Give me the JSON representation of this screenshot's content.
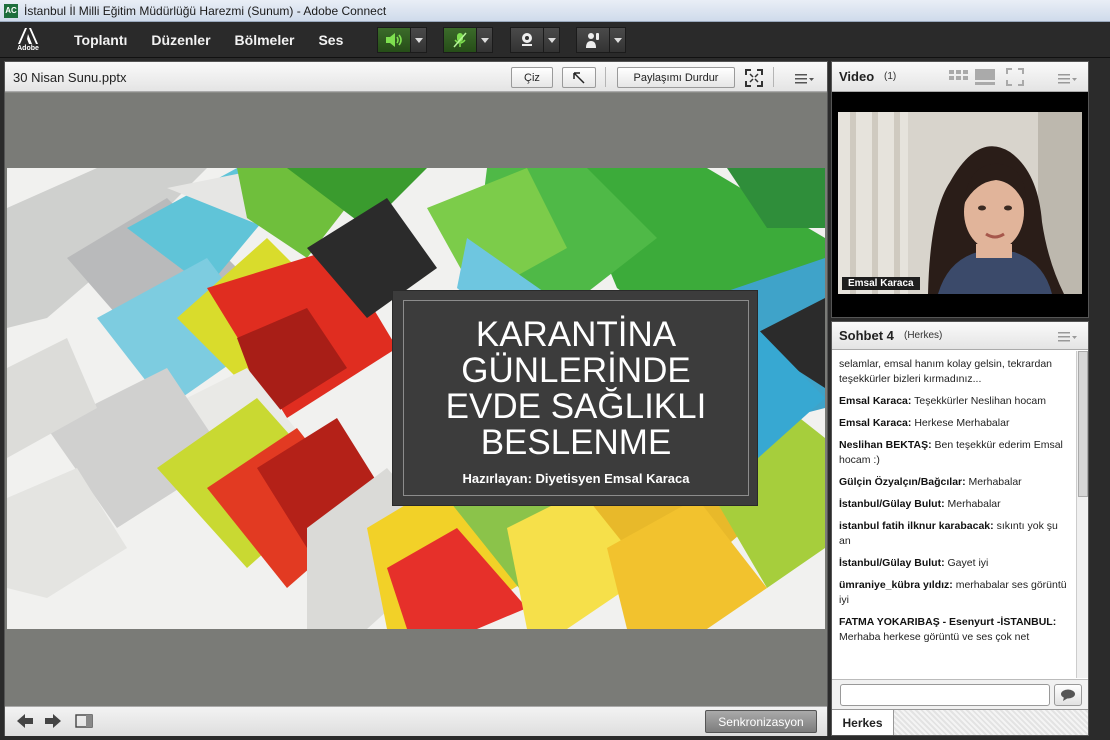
{
  "window": {
    "title": "İstanbul İl Milli Eğitim Müdürlüğü Harezmi (Sunum) - Adobe Connect"
  },
  "menubar": {
    "logo_text": "Adobe",
    "items": [
      "Toplantı",
      "Düzenler",
      "Bölmeler",
      "Ses"
    ]
  },
  "share_pod": {
    "title": "30 Nisan Sunu.pptx",
    "draw_label": "Çiz",
    "stop_share_label": "Paylaşımı Durdur",
    "slide": {
      "title_lines": [
        "KARANTİNA",
        "GÜNLERİNDE",
        "EVDE SAĞLIKLI",
        "BESLENME"
      ],
      "subtitle": "Hazırlayan: Diyetisyen Emsal Karaca"
    },
    "sync_label": "Senkronizasyon"
  },
  "video_pod": {
    "title": "Video",
    "count": "(1)",
    "presenter_name": "Emsal Karaca"
  },
  "chat_pod": {
    "title": "Sohbet 4",
    "scope": "(Herkes)",
    "messages": [
      {
        "sender": "",
        "text": "selamlar, emsal hanım kolay gelsin, tekrardan teşekkürler bizleri kırmadınız..."
      },
      {
        "sender": "Emsal Karaca:",
        "text": "Teşekkürler Neslihan hocam"
      },
      {
        "sender": "Emsal Karaca:",
        "text": "Herkese Merhabalar"
      },
      {
        "sender": "Neslihan BEKTAŞ:",
        "text": "Ben teşekkür ederim Emsal hocam :)"
      },
      {
        "sender": "Gülçin Özyalçın/Bağcılar:",
        "text": "Merhabalar"
      },
      {
        "sender": "İstanbul/Gülay Bulut:",
        "text": "Merhabalar"
      },
      {
        "sender": "istanbul fatih ilknur karabacak:",
        "text": "sıkıntı yok şu an"
      },
      {
        "sender": "İstanbul/Gülay Bulut:",
        "text": "Gayet iyi"
      },
      {
        "sender": "ümraniye_kübra yıldız:",
        "text": "merhabalar ses görüntü iyi"
      },
      {
        "sender": "FATMA YOKARIBAŞ - Esenyurt  -İSTANBUL:",
        "text": "Merhaba herkese görüntü ve ses çok net"
      }
    ],
    "input_value": "",
    "tab_label": "Herkes"
  },
  "colors": {
    "accent_green": "#5ec43a",
    "dark_bar": "#2a2a2a"
  }
}
